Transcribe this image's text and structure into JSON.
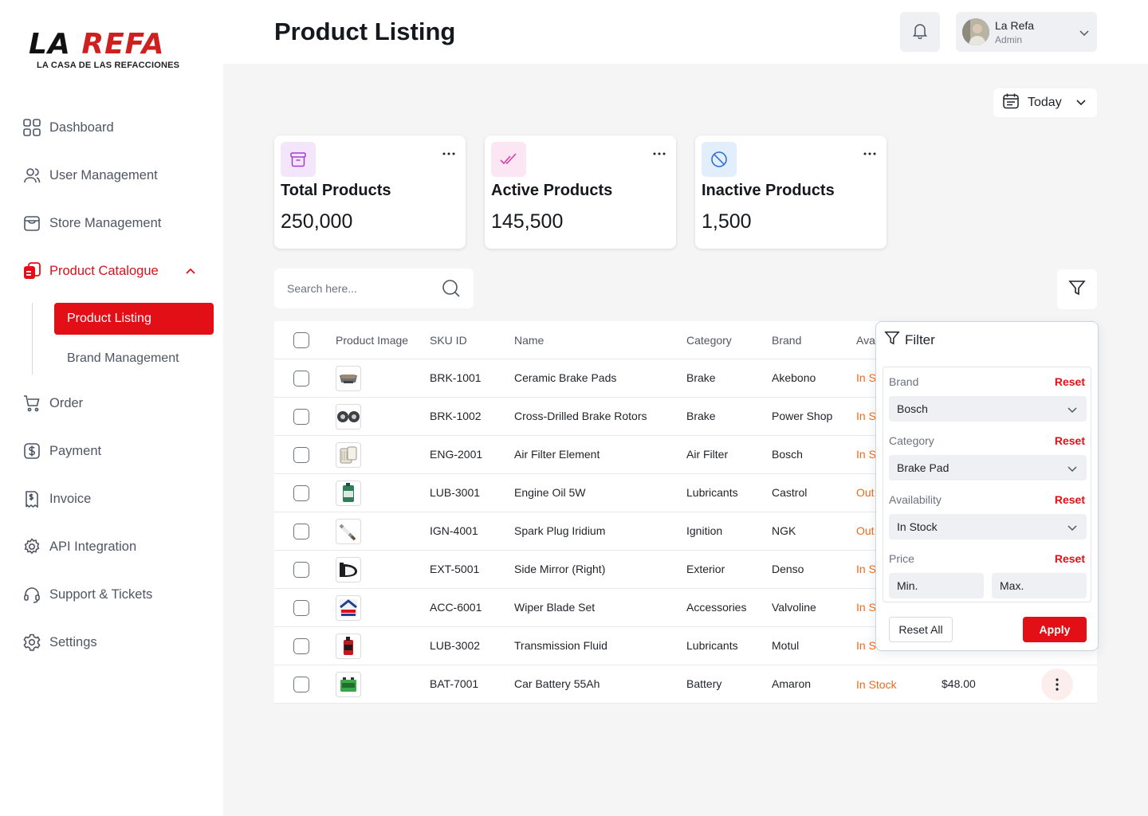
{
  "brand": {
    "name_left": "LA ",
    "name_right": "REFA",
    "tagline": "LA CASA DE LAS REFACCIONES"
  },
  "sidebar": {
    "items": [
      {
        "label": "Dashboard",
        "icon": "dashboard-grid-icon"
      },
      {
        "label": "User Management",
        "icon": "users-icon"
      },
      {
        "label": "Store Management",
        "icon": "store-icon"
      },
      {
        "label": "Product Catalogue",
        "icon": "catalogue-icon",
        "active": true
      },
      {
        "label": "Order",
        "icon": "cart-icon"
      },
      {
        "label": "Payment",
        "icon": "dollar-icon"
      },
      {
        "label": "Invoice",
        "icon": "invoice-icon"
      },
      {
        "label": "API Integration",
        "icon": "api-gear-icon"
      },
      {
        "label": "Support & Tickets",
        "icon": "headset-icon"
      },
      {
        "label": "Settings",
        "icon": "settings-icon"
      }
    ],
    "subitems": [
      {
        "label": "Product Listing",
        "active": true
      },
      {
        "label": "Brand Management"
      }
    ]
  },
  "header": {
    "title": "Product Listing",
    "user": {
      "name": "La Refa",
      "role": "Admin"
    }
  },
  "date_filter": {
    "label": "Today"
  },
  "stats": [
    {
      "title": "Total Products",
      "value": "250,000",
      "icon": "archive-box-icon",
      "color": "#f3e6fb"
    },
    {
      "title": "Active Products",
      "value": "145,500",
      "icon": "double-check-icon",
      "color": "#fce6f4"
    },
    {
      "title": "Inactive Products",
      "value": "1,500",
      "icon": "ban-icon",
      "color": "#e3eefc"
    }
  ],
  "search": {
    "placeholder": "Search here..."
  },
  "table": {
    "columns": [
      "Product Image",
      "SKU ID",
      "Name",
      "Category",
      "Brand",
      "Ava"
    ],
    "rows": [
      {
        "sku": "BRK-1001",
        "name": "Ceramic Brake Pads",
        "category": "Brake",
        "brand": "Akebono",
        "availability": "In S",
        "image": "brake-pads-image"
      },
      {
        "sku": "BRK-1002",
        "name": "Cross-Drilled Brake Rotors",
        "category": "Brake",
        "brand": "Power Shop",
        "availability": "In S",
        "image": "brake-rotors-image"
      },
      {
        "sku": "ENG-2001",
        "name": "Air Filter Element",
        "category": "Air Filter",
        "brand": "Bosch",
        "availability": "In S",
        "image": "air-filter-image"
      },
      {
        "sku": "LUB-3001",
        "name": "Engine Oil 5W",
        "category": "Lubricants",
        "brand": "Castrol",
        "availability": "Out",
        "image": "engine-oil-image"
      },
      {
        "sku": "IGN-4001",
        "name": "Spark Plug Iridium",
        "category": "Ignition",
        "brand": "NGK",
        "availability": "Out",
        "image": "spark-plug-image"
      },
      {
        "sku": "EXT-5001",
        "name": "Side Mirror (Right)",
        "category": "Exterior",
        "brand": "Denso",
        "availability": "In S",
        "image": "side-mirror-image"
      },
      {
        "sku": "ACC-6001",
        "name": "Wiper Blade Set",
        "category": "Accessories",
        "brand": "Valvoline",
        "availability": "In S",
        "image": "wiper-blade-image"
      },
      {
        "sku": "LUB-3002",
        "name": "Transmission Fluid",
        "category": "Lubricants",
        "brand": "Motul",
        "availability": "In St",
        "image": "transmission-fluid-image"
      },
      {
        "sku": "BAT-7001",
        "name": "Car Battery 55Ah",
        "category": "Battery",
        "brand": "Amaron",
        "availability": "In Stock",
        "price": "$48.00",
        "image": "car-battery-image"
      }
    ]
  },
  "filter_panel": {
    "title": "Filter",
    "brand": {
      "label": "Brand",
      "reset": "Reset",
      "value": "Bosch"
    },
    "category": {
      "label": "Category",
      "reset": "Reset",
      "value": "Brake Pad"
    },
    "availability": {
      "label": "Availability",
      "reset": "Reset",
      "value": "In Stock"
    },
    "price": {
      "label": "Price",
      "reset": "Reset",
      "min_placeholder": "Min.",
      "max_placeholder": "Max."
    },
    "reset_all": "Reset All",
    "apply": "Apply"
  },
  "colors": {
    "accent": "#e30f16",
    "availability": "#f26a17",
    "background": "#f5f5f6"
  }
}
